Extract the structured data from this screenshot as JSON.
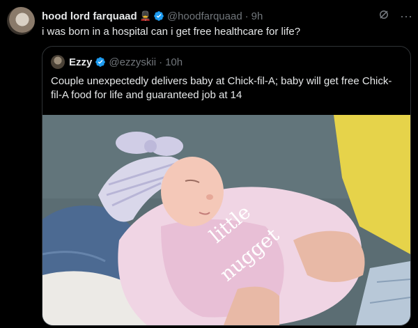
{
  "tweet": {
    "author": {
      "name": "hood lord farquaad",
      "emoji": "💂",
      "handle": "@hoodfarquaad",
      "time": "9h"
    },
    "text": "i was born in a hospital can i get free healthcare for life?",
    "icons": {
      "grok": "grok-icon",
      "more": "more-icon",
      "verified": "verified-badge-icon"
    }
  },
  "quote": {
    "author": {
      "name": "Ezzy",
      "handle": "@ezzyskii",
      "time": "10h"
    },
    "text": "Couple unexpectedly delivers baby at Chick-fil-A; baby will get free Chick-fil-A food for life and guaranteed job at 14",
    "media": {
      "onesie_text_1": "little",
      "onesie_text_2": "nugget"
    }
  },
  "colors": {
    "background": "#000000",
    "text_primary": "#e7e9ea",
    "text_secondary": "#71767b",
    "verified": "#1d9bf0",
    "border": "#2f3336"
  }
}
